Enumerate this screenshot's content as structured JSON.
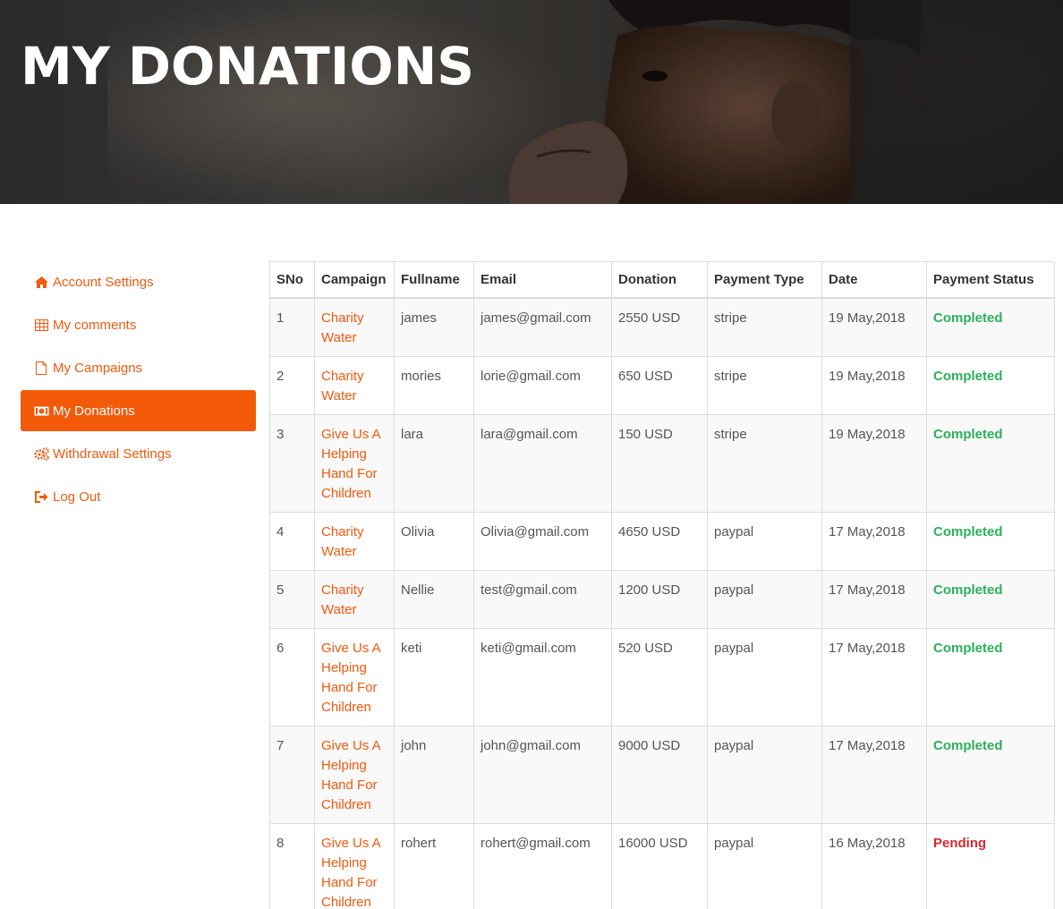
{
  "banner": {
    "title": "MY DONATIONS"
  },
  "sidebar": {
    "items": [
      {
        "label": "Account Settings",
        "icon": "home-icon",
        "active": false
      },
      {
        "label": "My comments",
        "icon": "table-icon",
        "active": false
      },
      {
        "label": "My Campaigns",
        "icon": "file-icon",
        "active": false
      },
      {
        "label": "My Donations",
        "icon": "money-icon",
        "active": true
      },
      {
        "label": "Withdrawal Settings",
        "icon": "gears-icon",
        "active": false
      },
      {
        "label": "Log Out",
        "icon": "sign-out-icon",
        "active": false
      }
    ]
  },
  "table": {
    "headers": [
      "SNo",
      "Campaign",
      "Fullname",
      "Email",
      "Donation",
      "Payment Type",
      "Date",
      "Payment Status"
    ],
    "rows": [
      {
        "sno": "1",
        "campaign": "Charity Water",
        "fullname": "james",
        "email": "james@gmail.com",
        "donation": "2550 USD",
        "payment_type": "stripe",
        "date": "19 May,2018",
        "status": "Completed"
      },
      {
        "sno": "2",
        "campaign": "Charity Water",
        "fullname": "mories",
        "email": "lorie@gmail.com",
        "donation": "650 USD",
        "payment_type": "stripe",
        "date": "19 May,2018",
        "status": "Completed"
      },
      {
        "sno": "3",
        "campaign": "Give Us A Helping Hand For Children",
        "fullname": "lara",
        "email": "lara@gmail.com",
        "donation": "150 USD",
        "payment_type": "stripe",
        "date": "19 May,2018",
        "status": "Completed"
      },
      {
        "sno": "4",
        "campaign": "Charity Water",
        "fullname": "Olivia",
        "email": "Olivia@gmail.com",
        "donation": "4650 USD",
        "payment_type": "paypal",
        "date": "17 May,2018",
        "status": "Completed"
      },
      {
        "sno": "5",
        "campaign": "Charity Water",
        "fullname": "Nellie",
        "email": "test@gmail.com",
        "donation": "1200 USD",
        "payment_type": "paypal",
        "date": "17 May,2018",
        "status": "Completed"
      },
      {
        "sno": "6",
        "campaign": "Give Us A Helping Hand For Children",
        "fullname": "keti",
        "email": "keti@gmail.com",
        "donation": "520 USD",
        "payment_type": "paypal",
        "date": "17 May,2018",
        "status": "Completed"
      },
      {
        "sno": "7",
        "campaign": "Give Us A Helping Hand For Children",
        "fullname": "john",
        "email": "john@gmail.com",
        "donation": "9000 USD",
        "payment_type": "paypal",
        "date": "17 May,2018",
        "status": "Completed"
      },
      {
        "sno": "8",
        "campaign": "Give Us A Helping Hand For Children",
        "fullname": "rohert",
        "email": "rohert@gmail.com",
        "donation": "16000 USD",
        "payment_type": "paypal",
        "date": "16 May,2018",
        "status": "Pending"
      }
    ]
  },
  "colors": {
    "accent": "#f25a0a",
    "completed": "#2db05a",
    "pending": "#d9282f"
  }
}
